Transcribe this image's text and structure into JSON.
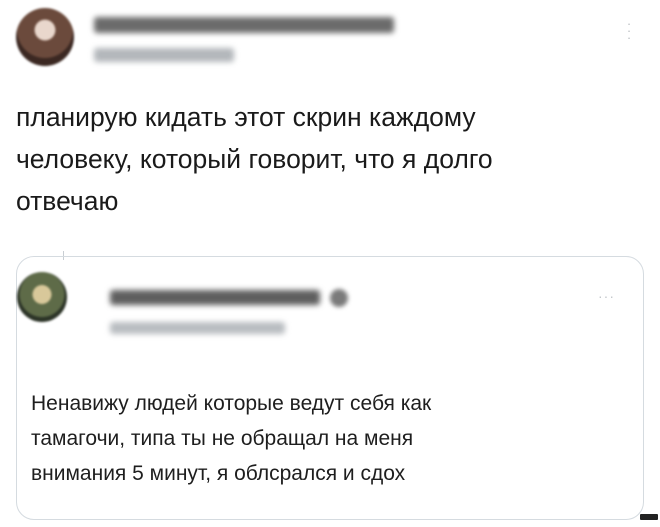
{
  "tweet": {
    "text": "планирую кидать этот скрин каждому\nчеловеку, который говорит, что я долго\nотвечаю",
    "more_icon": "more-vertical-icon"
  },
  "quoted_tweet": {
    "text": "Ненавижу людей которые ведут себя как\nтамагочи, типа ты не обращал на меня\nвнимания 5 минут, я облсрался и сдох",
    "more_label": "···",
    "verified_icon": "verified-badge-icon"
  },
  "colors": {
    "text": "#1a1a1a",
    "border": "#d5dbe0",
    "muted": "#b3b7bb"
  }
}
